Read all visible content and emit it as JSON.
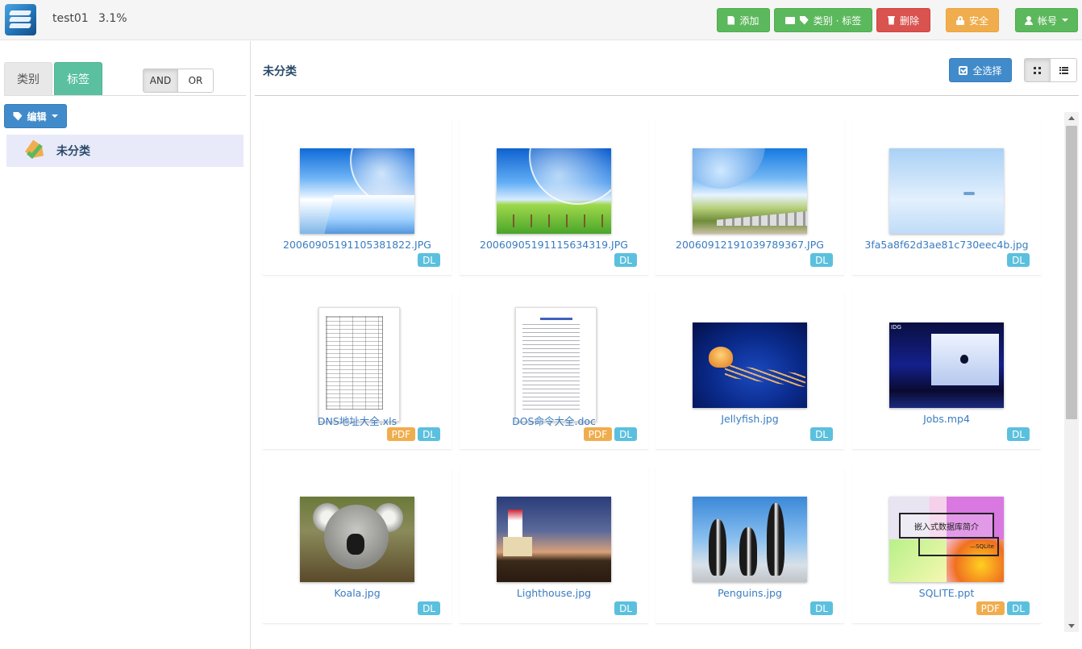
{
  "header": {
    "user": "test01",
    "usage": "3.1%",
    "buttons": {
      "add": "添加",
      "category_tag": "类别 · 标签",
      "delete": "删除",
      "security": "安全",
      "account": "帐号"
    },
    "colors": {
      "add": "#5cb85c",
      "delete": "#d9534f",
      "security": "#f0ad4e"
    }
  },
  "sidebar": {
    "tabs": {
      "category": "类别",
      "tag": "标签"
    },
    "logic": {
      "and": "AND",
      "or": "OR"
    },
    "edit_button": "编辑",
    "tree": [
      {
        "label": "未分类",
        "icon": "tag-check-icon"
      }
    ]
  },
  "main": {
    "title": "未分类",
    "select_all": "全选择",
    "view_modes": [
      "grid-view-icon",
      "list-view-icon"
    ],
    "files": [
      {
        "name": "20060905191105381822.JPG",
        "badges": [
          "DL"
        ]
      },
      {
        "name": "20060905191115634319.JPG",
        "badges": [
          "DL"
        ]
      },
      {
        "name": "20060912191039789367.JPG",
        "badges": [
          "DL"
        ]
      },
      {
        "name": "3fa5a8f62d3ae81c730eec4b.jpg",
        "badges": [
          "DL"
        ]
      },
      {
        "name": "DNS地址大全.xls",
        "badges": [
          "PDF",
          "DL"
        ]
      },
      {
        "name": "DOS命令大全.doc",
        "badges": [
          "PDF",
          "DL"
        ]
      },
      {
        "name": "Jellyfish.jpg",
        "badges": [
          "DL"
        ]
      },
      {
        "name": "Jobs.mp4",
        "badges": [
          "DL"
        ]
      },
      {
        "name": "Koala.jpg",
        "badges": [
          "DL"
        ]
      },
      {
        "name": "Lighthouse.jpg",
        "badges": [
          "DL"
        ]
      },
      {
        "name": "Penguins.jpg",
        "badges": [
          "DL"
        ]
      },
      {
        "name": "SQLITE.ppt",
        "badges": [
          "PDF",
          "DL"
        ]
      }
    ],
    "thumb_text": {
      "sqlite_title": "嵌入式数据库简介",
      "sqlite_sub": "—SQLite",
      "jobs_logo": "IDG"
    }
  }
}
